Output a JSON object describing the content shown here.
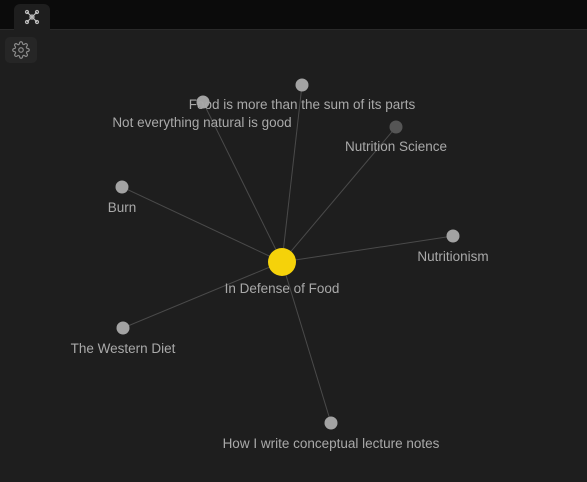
{
  "tabbar": {
    "active_tab_icon": "graph-view-icon"
  },
  "toolbar": {
    "settings_icon": "gear-icon"
  },
  "graph": {
    "center_label": "In Defense of Food",
    "nodes": [
      {
        "id": "food-sum",
        "label": "Food is more than the sum of its parts"
      },
      {
        "id": "not-natural",
        "label": "Not everything natural is good"
      },
      {
        "id": "nutrition-science",
        "label": "Nutrition Science"
      },
      {
        "id": "burn",
        "label": "Burn"
      },
      {
        "id": "nutritionism",
        "label": "Nutritionism"
      },
      {
        "id": "western-diet",
        "label": "The Western Diet"
      },
      {
        "id": "lecture-notes",
        "label": "How I write conceptual lecture notes"
      }
    ],
    "colors": {
      "center_node": "#f5d20a",
      "node": "#a3a3a3",
      "node_dim": "#555555",
      "edge": "#4a4a4a",
      "label": "#a9a9a9"
    }
  }
}
